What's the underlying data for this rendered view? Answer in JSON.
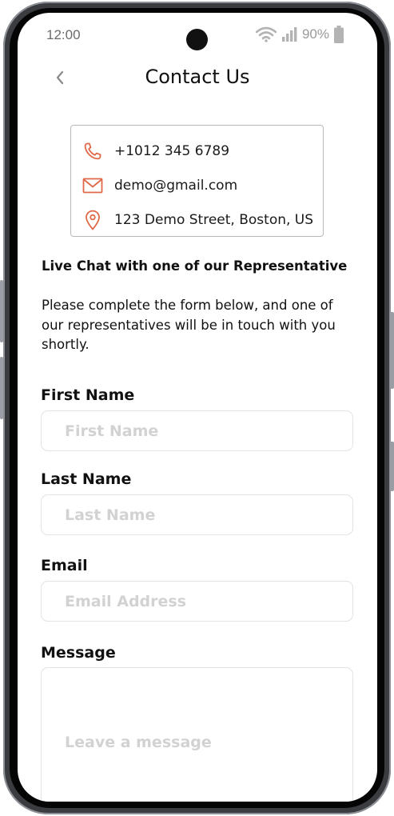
{
  "status": {
    "time": "12:00",
    "battery": "90%"
  },
  "header": {
    "title": "Contact Us"
  },
  "contact": {
    "phone": "+1012 345 6789",
    "email": "demo@gmail.com",
    "address": "123 Demo Street, Boston, US"
  },
  "live_chat_heading": "Live Chat with one of our Representative",
  "intro_text": "Please complete the form below, and one of our representatives will be in touch with you shortly.",
  "form": {
    "first_name": {
      "label": "First Name",
      "placeholder": "First Name",
      "value": ""
    },
    "last_name": {
      "label": "Last Name",
      "placeholder": "Last Name",
      "value": ""
    },
    "email": {
      "label": "Email",
      "placeholder": "Email Address",
      "value": ""
    },
    "message": {
      "label": "Message",
      "placeholder": "Leave a message",
      "value": ""
    }
  },
  "colors": {
    "accent": "#e0694a",
    "text": "#111111",
    "placeholder": "#d2d2d2",
    "input_border": "#e3e3e3",
    "card_border": "#b9b9b9"
  },
  "icons": {
    "back": "chevron-left-icon",
    "phone": "phone-icon",
    "email": "mail-icon",
    "address": "location-pin-icon",
    "wifi": "wifi-icon",
    "signal": "signal-icon",
    "battery": "battery-icon"
  }
}
